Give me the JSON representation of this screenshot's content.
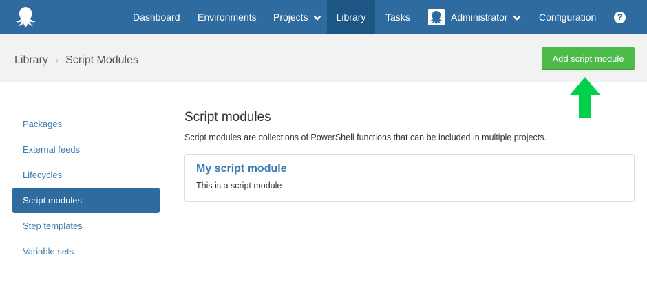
{
  "topnav": {
    "logo_icon": "octopus-logo-icon",
    "items": [
      {
        "label": "Dashboard"
      },
      {
        "label": "Environments"
      },
      {
        "label": "Projects",
        "has_dropdown": true
      },
      {
        "label": "Library",
        "active": true
      },
      {
        "label": "Tasks"
      },
      {
        "label": "Administrator",
        "has_dropdown": true,
        "avatar": "octopus-avatar-icon"
      },
      {
        "label": "Configuration"
      }
    ],
    "help_label": "?"
  },
  "breadcrumb": {
    "parent": "Library",
    "separator": "›",
    "current": "Script Modules"
  },
  "toolbar": {
    "add_label": "Add script module",
    "add_color": "#4cbb4a"
  },
  "annotation": {
    "arrow_color": "#00d14a",
    "icon": "up-arrow-icon"
  },
  "sidebar": {
    "items": [
      {
        "label": "Packages"
      },
      {
        "label": "External feeds"
      },
      {
        "label": "Lifecycles"
      },
      {
        "label": "Script modules",
        "active": true
      },
      {
        "label": "Step templates"
      },
      {
        "label": "Variable sets"
      }
    ]
  },
  "main": {
    "title": "Script modules",
    "description": "Script modules are collections of PowerShell functions that can be included in multiple projects.",
    "modules": [
      {
        "name": "My script module",
        "description": "This is a script module"
      }
    ]
  },
  "colors": {
    "nav_bg": "#2f6b9e",
    "nav_active": "#1d5585",
    "link": "#3d7bb0"
  }
}
